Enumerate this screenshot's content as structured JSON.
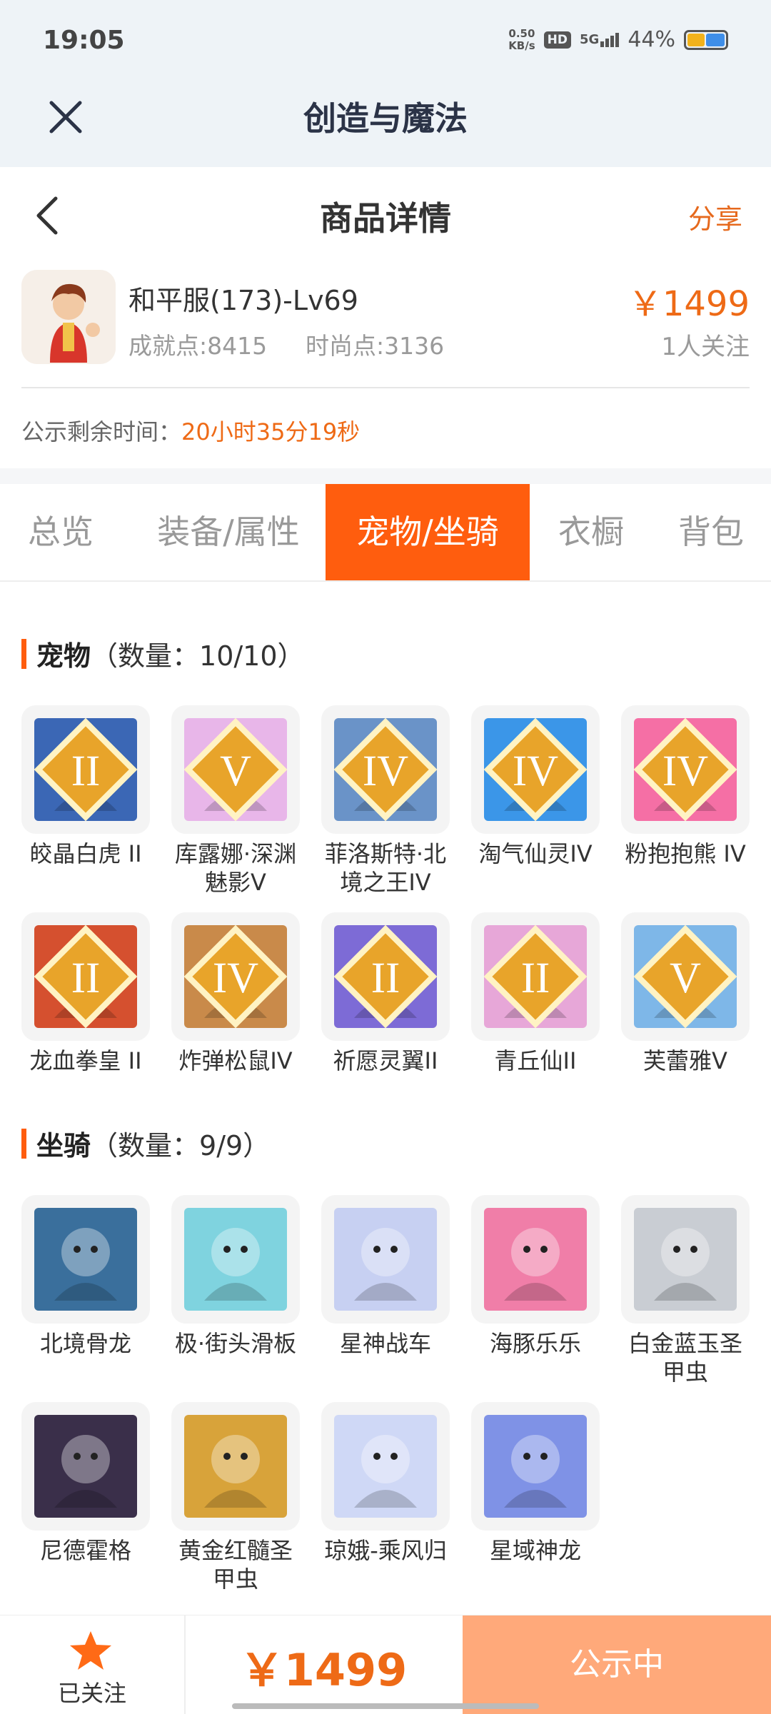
{
  "status_bar": {
    "time": "19:05",
    "speed_value": "0.50",
    "speed_unit": "KB/s",
    "hd": "HD",
    "network": "5G",
    "battery": "44%"
  },
  "app": {
    "title": "创造与魔法"
  },
  "header": {
    "title": "商品详情",
    "share": "分享"
  },
  "product": {
    "name": "和平服(173)-Lv69",
    "achievement": "成就点:8415",
    "fashion": "时尚点:3136",
    "price": "￥1499",
    "followers": "1人关注"
  },
  "countdown": {
    "label": "公示剩余时间：",
    "value": "20小时35分19秒"
  },
  "tabs": [
    {
      "label": "总览"
    },
    {
      "label": "装备/属性"
    },
    {
      "label": "宠物/坐骑"
    },
    {
      "label": "衣橱"
    },
    {
      "label": "背包"
    }
  ],
  "pets": {
    "title": "宠物",
    "count": "（数量：10/10）",
    "items": [
      {
        "name": "皎晶白虎 II",
        "badge": "II",
        "color": "#3b67b5"
      },
      {
        "name": "库露娜·深渊魅影V",
        "badge": "V",
        "color": "#e8b6e9"
      },
      {
        "name": "菲洛斯特·北境之王IV",
        "badge": "IV",
        "color": "#6a93c8"
      },
      {
        "name": "淘气仙灵IV",
        "badge": "IV",
        "color": "#3b96e8"
      },
      {
        "name": "粉抱抱熊 IV",
        "badge": "IV",
        "color": "#f56fa5"
      },
      {
        "name": "龙血拳皇 II",
        "badge": "II",
        "color": "#d5502f"
      },
      {
        "name": "炸弹松鼠IV",
        "badge": "IV",
        "color": "#c98a4a"
      },
      {
        "name": "祈愿灵翼II",
        "badge": "II",
        "color": "#7d6bd6"
      },
      {
        "name": "青丘仙II",
        "badge": "II",
        "color": "#e7a7d8"
      },
      {
        "name": "芙蕾雅V",
        "badge": "V",
        "color": "#7eb7e8"
      }
    ]
  },
  "mounts": {
    "title": "坐骑",
    "count": "（数量：9/9）",
    "items": [
      {
        "name": "北境骨龙",
        "color": "#3a6f9c"
      },
      {
        "name": "极·街头滑板",
        "color": "#7fd3df"
      },
      {
        "name": "星神战车",
        "color": "#c7d0f2"
      },
      {
        "name": "海豚乐乐",
        "color": "#f07ea8"
      },
      {
        "name": "白金蓝玉圣甲虫",
        "color": "#c9cdd3"
      },
      {
        "name": "尼德霍格",
        "color": "#3a2f4a"
      },
      {
        "name": "黄金红髓圣甲虫",
        "color": "#d8a33a"
      },
      {
        "name": "琼娥-乘风归",
        "color": "#cfd8f6"
      },
      {
        "name": "星域神龙",
        "color": "#7f92e6"
      }
    ]
  },
  "bottom_bar": {
    "follow_label": "已关注",
    "price": "￥1499",
    "status": "公示中"
  }
}
